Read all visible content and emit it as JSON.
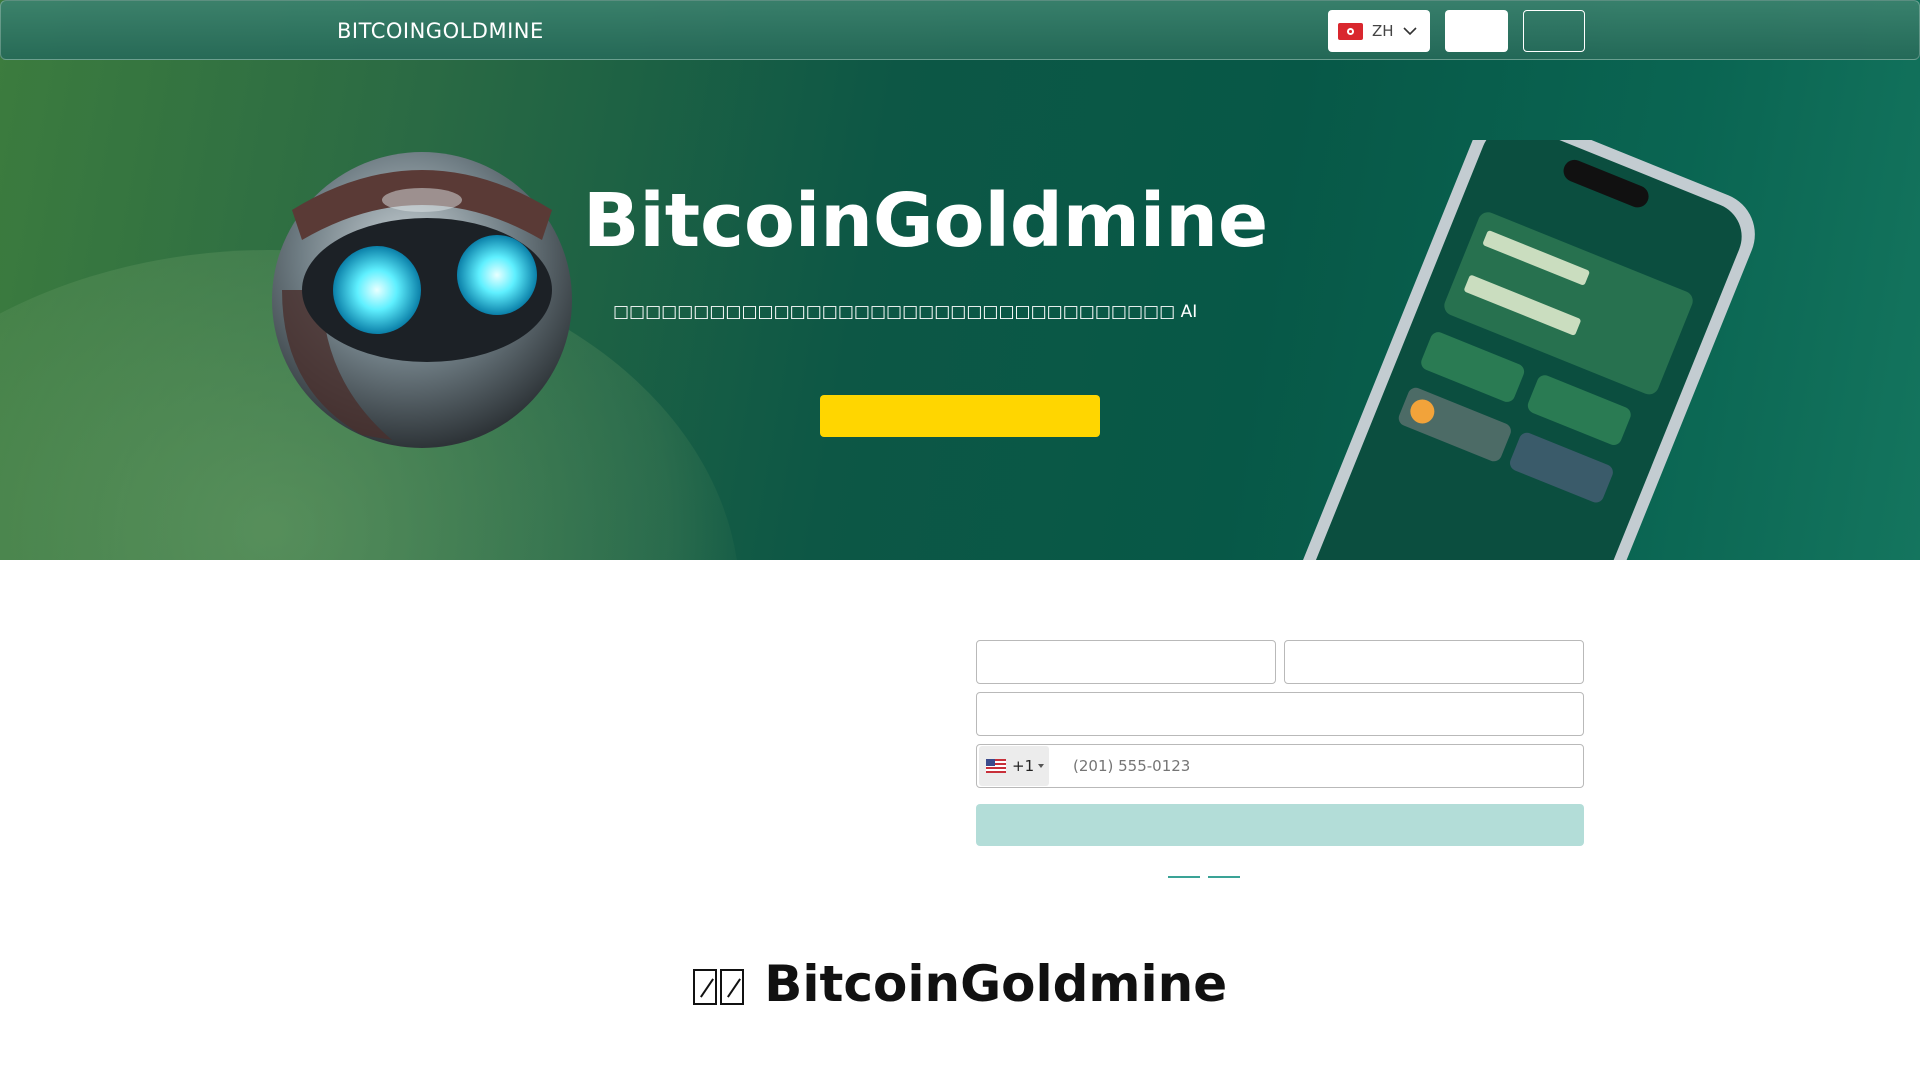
{
  "header": {
    "brand": "BITCOINGOLDMINE",
    "language": {
      "code": "ZH",
      "flag_icon": "hong-kong-flag-icon"
    },
    "login_label": "",
    "signup_label": ""
  },
  "hero": {
    "title": "BitcoinGoldmine",
    "subtitle": "□□□□□□□□□□□□□□□□□□□□□□□□□□□□□□□□□□□ AI",
    "cta_label": ""
  },
  "form": {
    "first_name_placeholder": "",
    "last_name_placeholder": "",
    "email_placeholder": "",
    "phone": {
      "country_flag": "us-flag-icon",
      "dial_code": "+1",
      "placeholder": "(201) 555-0123"
    },
    "submit_label": ""
  },
  "about": {
    "title_prefix": "",
    "title": "BitcoinGoldmine"
  },
  "colors": {
    "accent_yellow": "#ffd600",
    "submit_disabled": "#b3ddd8",
    "hero_green": "#075847"
  }
}
